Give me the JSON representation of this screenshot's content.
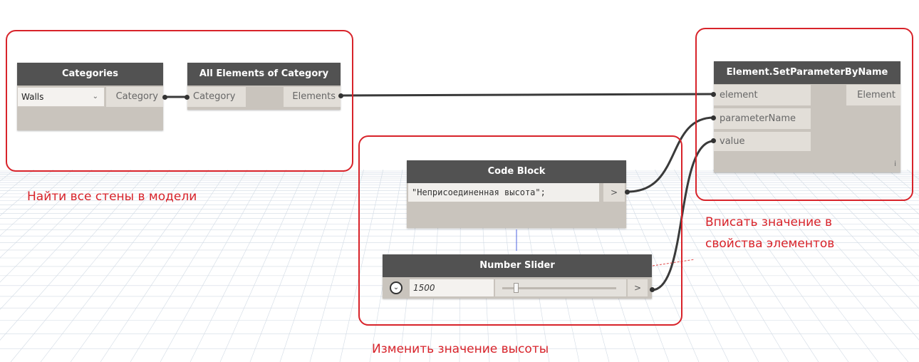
{
  "nodes": {
    "categories": {
      "title": "Categories",
      "dropdown_value": "Walls",
      "output": "Category"
    },
    "all_elements": {
      "title": "All Elements of Category",
      "input": "Category",
      "output": "Elements"
    },
    "set_param": {
      "title": "Element.SetParameterByName",
      "inputs": [
        "element",
        "parameterName",
        "value"
      ],
      "output": "Element",
      "info_mark": "i"
    },
    "code_block": {
      "title": "Code Block",
      "code": "\"Неприсоединенная высота\";",
      "output": ">"
    },
    "number_slider": {
      "title": "Number Slider",
      "toggle_icon": "⌄",
      "value": "1500",
      "position": 0.1,
      "output": ">"
    }
  },
  "annotations": {
    "find_walls": "Найти все стены в модели",
    "write_value_line1": "Вписать значение в",
    "write_value_line2": "свойства элементов",
    "change_height": "Изменить значение высоты"
  },
  "colors": {
    "annotation_red": "#d8232a",
    "node_header": "#525252",
    "node_body": "#c9c4bd",
    "wire": "#3a3a3a"
  },
  "icons": {
    "dropdown": "chevron-down-icon",
    "slider_toggle": "collapse-toggle-icon"
  }
}
